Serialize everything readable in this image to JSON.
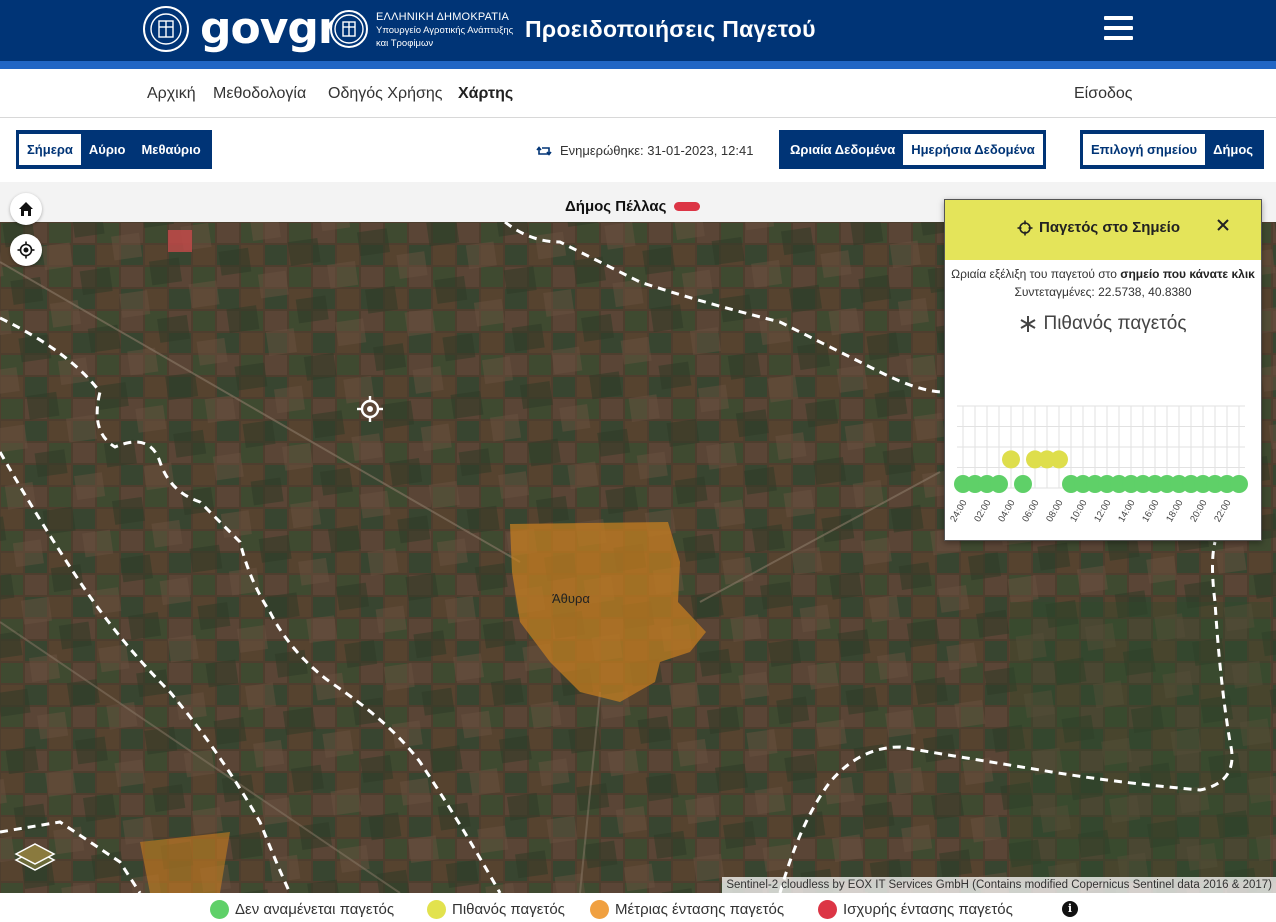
{
  "header": {
    "logo": "govgr",
    "ministry_lines": [
      "ΕΛΛΗΝΙΚΗ ΔΗΜΟΚΡΑΤΙΑ",
      "Υπουργείο Αγροτικής Ανάπτυξης",
      "και Τροφίμων"
    ],
    "title": "Προειδοποιήσεις Παγετού",
    "bg_color": "#003476",
    "stripe_color": "#2166c4"
  },
  "nav": {
    "items": [
      "Αρχική",
      "Μεθοδολογία",
      "Οδηγός Χρήσης",
      "Χάρτης"
    ],
    "active": "Χάρτης",
    "login": "Είσοδος"
  },
  "controls": {
    "day_options": [
      "Σήμερα",
      "Αύριο",
      "Μεθαύριο"
    ],
    "day_selected": "Σήμερα",
    "updated": "Ενημερώθηκε: 31-01-2023, 12:41",
    "data_options": [
      "Ωριαία Δεδομένα",
      "Ημερήσια Δεδομένα"
    ],
    "data_selected": "Ημερήσια Δεδομένα",
    "select_options": [
      "Επιλογή σημείου",
      "Δήμος"
    ],
    "select_selected": "Επιλογή σημείου"
  },
  "map": {
    "municipality": "Δήμος Πέλλας",
    "municipality_color": "#dc3545",
    "place": "Άθυρα",
    "attribution": "Sentinel-2 cloudless by EOX IT Services GmbH (Contains modified Copernicus Sentinel data 2016 & 2017)",
    "home_icon": "home-icon",
    "locate_icon": "locate-icon"
  },
  "popup": {
    "title": "Παγετός στο Σημείο",
    "desc_prefix": "Ωριαία εξέλιξη του παγετού στο ",
    "desc_bold": "σημείο που κάνατε κλικ",
    "coords": "Συντεταγμένες: 22.5738, 40.8380",
    "status": "Πιθανός παγετός",
    "status_icon": "snowflake-icon",
    "header_color": "#e4e45a"
  },
  "chart_data": {
    "type": "scatter",
    "x": [
      "24:00",
      "01:00",
      "02:00",
      "03:00",
      "04:00",
      "05:00",
      "06:00",
      "07:00",
      "08:00",
      "09:00",
      "10:00",
      "11:00",
      "12:00",
      "13:00",
      "14:00",
      "15:00",
      "16:00",
      "17:00",
      "18:00",
      "19:00",
      "20:00",
      "21:00",
      "22:00",
      "23:00"
    ],
    "tick_labels": [
      "24:00",
      "02:00",
      "04:00",
      "06:00",
      "08:00",
      "10:00",
      "12:00",
      "14:00",
      "16:00",
      "18:00",
      "20:00",
      "22:00"
    ],
    "levels": [
      0,
      0,
      0,
      0,
      1,
      0,
      1,
      1,
      1,
      0,
      0,
      0,
      0,
      0,
      0,
      0,
      0,
      0,
      0,
      0,
      0,
      0,
      0,
      0
    ],
    "level_colors": [
      "#5fd068",
      "#dede4c",
      "#f0a040",
      "#dc3545"
    ],
    "ylim": [
      0,
      3
    ]
  },
  "legend": {
    "items": [
      {
        "label": "Δεν αναμένεται παγετός",
        "color": "#5fd068"
      },
      {
        "label": "Πιθανός παγετός",
        "color": "#e2e24e"
      },
      {
        "label": "Μέτριας έντασης παγετός",
        "color": "#f0a040"
      },
      {
        "label": "Ισχυρής έντασης παγετός",
        "color": "#dc3545"
      }
    ],
    "info_icon": "info-icon"
  }
}
